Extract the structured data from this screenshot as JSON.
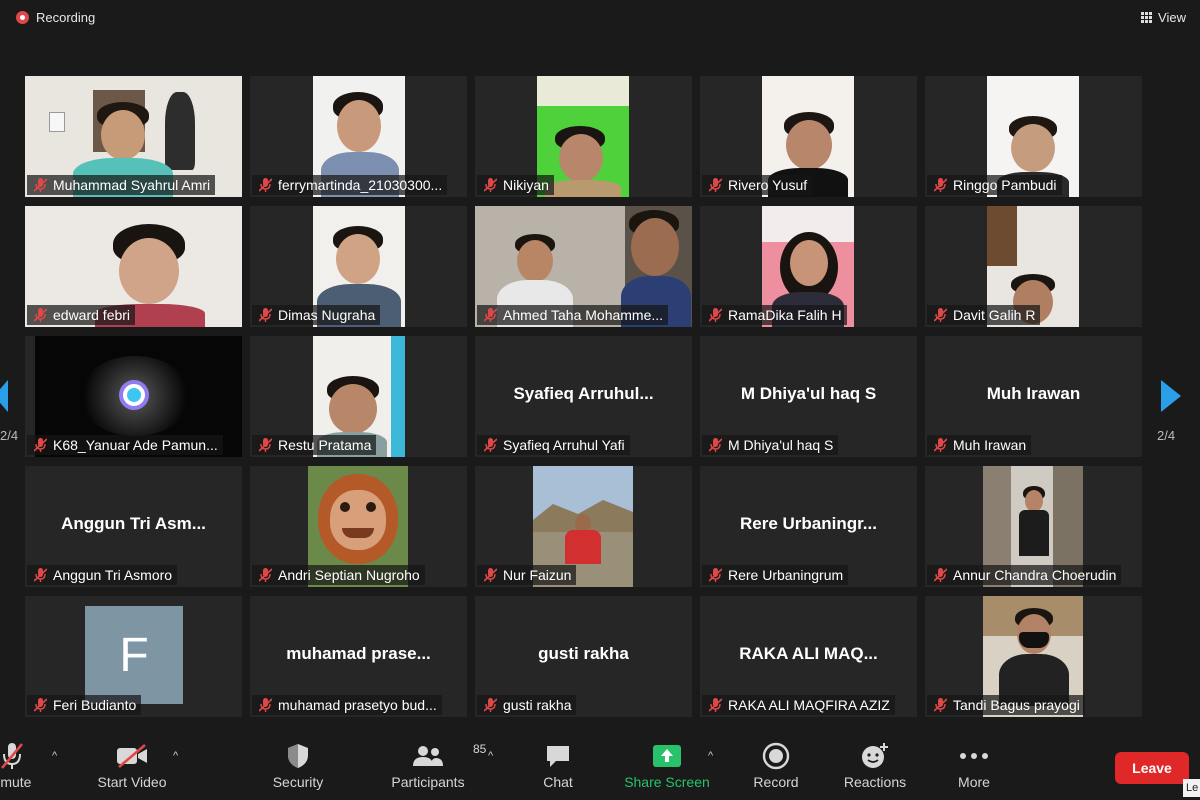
{
  "top_bar": {
    "recording_label": "Recording",
    "view_label": "View"
  },
  "pagination": {
    "left_page": "2/4",
    "right_page": "2/4"
  },
  "participants": [
    {
      "label": "Muhammad Syahrul Amri",
      "center": ""
    },
    {
      "label": "ferrymartinda_21030300...",
      "center": ""
    },
    {
      "label": "Nikiyan",
      "center": ""
    },
    {
      "label": "Rivero Yusuf",
      "center": ""
    },
    {
      "label": "Ringgo Pambudi",
      "center": ""
    },
    {
      "label": "edward febri",
      "center": ""
    },
    {
      "label": "Dimas Nugraha",
      "center": ""
    },
    {
      "label": "Ahmed Taha Mohamme...",
      "center": ""
    },
    {
      "label": "RamaDika Falih H",
      "center": ""
    },
    {
      "label": "Davit Galih R",
      "center": ""
    },
    {
      "label": "K68_Yanuar Ade Pamun...",
      "center": ""
    },
    {
      "label": "Restu Pratama",
      "center": ""
    },
    {
      "label": "Syafieq Arruhul Yafi",
      "center": "Syafieq  Arruhul..."
    },
    {
      "label": "M Dhiya'ul haq S",
      "center": "M Dhiya'ul haq S"
    },
    {
      "label": "Muh Irawan",
      "center": "Muh Irawan"
    },
    {
      "label": "Anggun Tri Asmoro",
      "center": "Anggun  Tri Asm..."
    },
    {
      "label": "Andri Septian Nugroho",
      "center": ""
    },
    {
      "label": "Nur Faizun",
      "center": ""
    },
    {
      "label": "Rere Urbaningrum",
      "center": "Rere  Urbaningr..."
    },
    {
      "label": "Annur Chandra Choerudin",
      "center": ""
    },
    {
      "label": "Feri Budianto",
      "center": "",
      "avatar_letter": "F"
    },
    {
      "label": "muhamad prasetyo bud...",
      "center": "muhamad  prase..."
    },
    {
      "label": "gusti rakha",
      "center": "gusti rakha"
    },
    {
      "label": "RAKA ALI MAQFIRA AZIZ",
      "center": "RAKA ALI MAQ..."
    },
    {
      "label": "Tandi Bagus prayogi",
      "center": ""
    }
  ],
  "toolbar": {
    "unmute": "nmute",
    "start_video": "Start Video",
    "security": "Security",
    "participants": "Participants",
    "participants_count": "85",
    "chat": "Chat",
    "share_screen": "Share Screen",
    "record": "Record",
    "reactions": "Reactions",
    "more": "More",
    "leave": "Leave",
    "tooltip": "Le"
  },
  "colors": {
    "accent_blue": "#2a9fe8",
    "leave_red": "#e02828",
    "share_green": "#27c26a",
    "muted_red": "#e04848"
  }
}
